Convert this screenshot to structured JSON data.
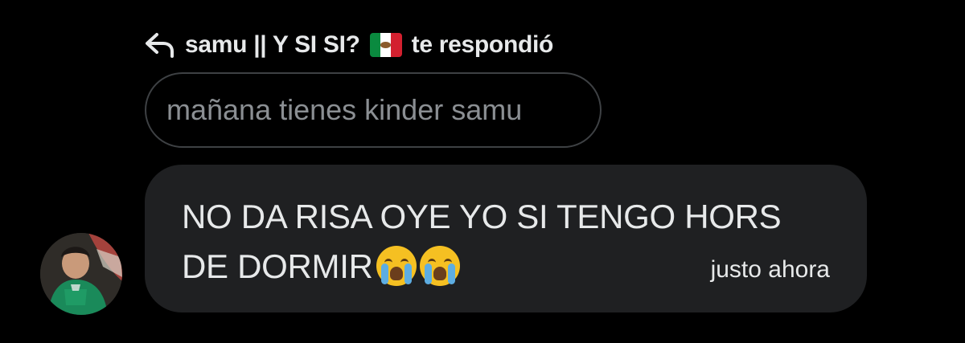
{
  "reply_header": {
    "icon": "reply-arrow-icon",
    "user_name": "samu || Y SI SI?",
    "flag_icon": "mexico-flag-icon",
    "suffix": "te respondió"
  },
  "quoted_message": {
    "text": "mañana tienes kinder samu"
  },
  "message": {
    "line1": "NO DA RISA OYE YO SI TENGO HORS",
    "line2": "DE DORMIR",
    "emojis": [
      "loudly-crying-face-icon",
      "loudly-crying-face-icon"
    ],
    "timestamp": "justo ahora",
    "bubble_color": "#1f2022"
  },
  "avatar": {
    "icon": "user-avatar"
  },
  "colors": {
    "background": "#000000",
    "text": "#e7e9ea",
    "muted_text": "#8b8f93",
    "quote_border": "#3e4144"
  }
}
